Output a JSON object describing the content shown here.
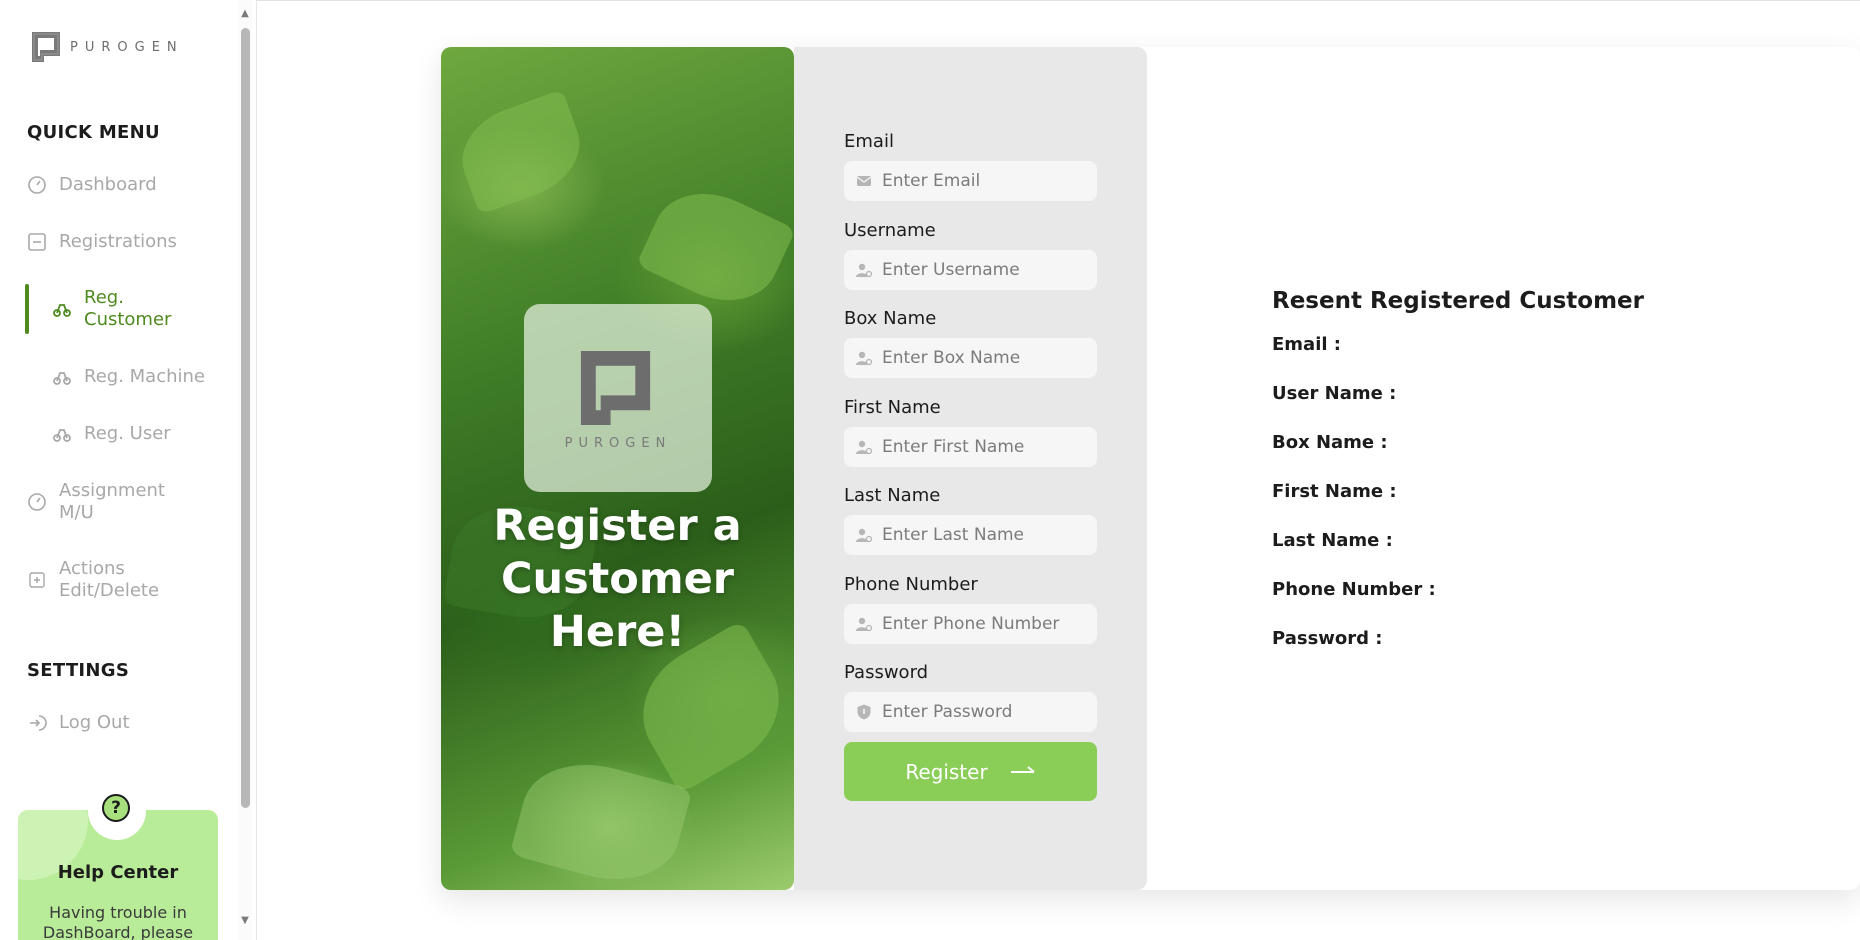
{
  "logo": {
    "text": "PUROGEN"
  },
  "sidebar": {
    "quick_menu_title": "QUICK MENU",
    "items": [
      {
        "label": "Dashboard",
        "icon": "gauge-icon"
      },
      {
        "label": "Registrations",
        "icon": "minus-square-icon"
      },
      {
        "label": "Reg. Customer",
        "icon": "scooter-icon",
        "active": true
      },
      {
        "label": "Reg. Machine",
        "icon": "scooter-icon"
      },
      {
        "label": "Reg. User",
        "icon": "scooter-icon"
      },
      {
        "label": "Assignment M/U",
        "icon": "gauge-icon"
      },
      {
        "label": "Actions Edit/Delete",
        "icon": "plus-square-icon"
      }
    ],
    "settings_title": "SETTINGS",
    "logout_label": "Log Out",
    "help": {
      "icon": "?",
      "title": "Help Center",
      "text": "Having trouble in DashBoard, please"
    }
  },
  "hero": {
    "logo_text": "PUROGEN",
    "title_lines": [
      "Register a",
      "Customer",
      "Here!"
    ]
  },
  "form": {
    "fields": [
      {
        "label": "Email",
        "placeholder": "Enter Email",
        "icon": "email-icon"
      },
      {
        "label": "Username",
        "placeholder": "Enter Username",
        "icon": "user-icon"
      },
      {
        "label": "Box Name",
        "placeholder": "Enter Box Name",
        "icon": "user-icon"
      },
      {
        "label": "First Name",
        "placeholder": "Enter First Name",
        "icon": "user-icon"
      },
      {
        "label": "Last Name",
        "placeholder": "Enter Last Name",
        "icon": "user-icon"
      },
      {
        "label": "Phone Number",
        "placeholder": "Enter Phone Number",
        "icon": "user-icon"
      },
      {
        "label": "Password",
        "placeholder": "Enter Password",
        "icon": "shield-icon"
      }
    ],
    "register_label": "Register",
    "register_icon": "arrow-right-icon"
  },
  "recent": {
    "title": "Resent Registered Customer",
    "rows": [
      "Email :",
      "User Name :",
      "Box Name :",
      "First Name :",
      "Last Name :",
      "Phone Number :",
      "Password :"
    ]
  },
  "colors": {
    "accent_green": "#8bce57",
    "active_green": "#4f8a1f",
    "help_card": "#b9ec99",
    "form_panel": "#e8e8e8"
  }
}
